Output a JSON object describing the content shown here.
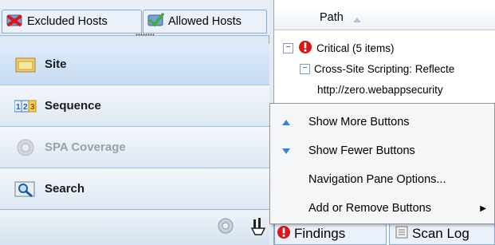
{
  "nav_tabs": [
    {
      "label": "Excluded Hosts"
    },
    {
      "label": "Allowed Hosts"
    }
  ],
  "nav_buttons": [
    {
      "label": "Site",
      "icon": "folder-icon",
      "selected": true
    },
    {
      "label": "Sequence",
      "icon": "sequence-icon",
      "selected": false
    },
    {
      "label": "SPA Coverage",
      "icon": "spa-coverage-icon",
      "disabled": true
    },
    {
      "label": "Search",
      "icon": "search-icon",
      "selected": false
    }
  ],
  "results": {
    "column_header": "Path",
    "rows": [
      {
        "label": "Critical (5 items)"
      },
      {
        "label": "Cross-Site Scripting: Reflecte"
      },
      {
        "label": "http://zero.webappsecurity"
      }
    ]
  },
  "context_menu": {
    "items": [
      {
        "label": "Show More Buttons",
        "access_key": "M"
      },
      {
        "label": "Show Fewer Buttons",
        "access_key": "F"
      },
      {
        "label": "Navigation Pane Options...",
        "access_key": "v"
      },
      {
        "label": "Add or Remove Buttons",
        "access_key": "A"
      }
    ]
  },
  "bottom_tabs": [
    {
      "label": "Findings"
    },
    {
      "label": "Scan Log"
    }
  ],
  "colors": {
    "accent": "#4a8fd8",
    "critical": "#d8161b"
  }
}
